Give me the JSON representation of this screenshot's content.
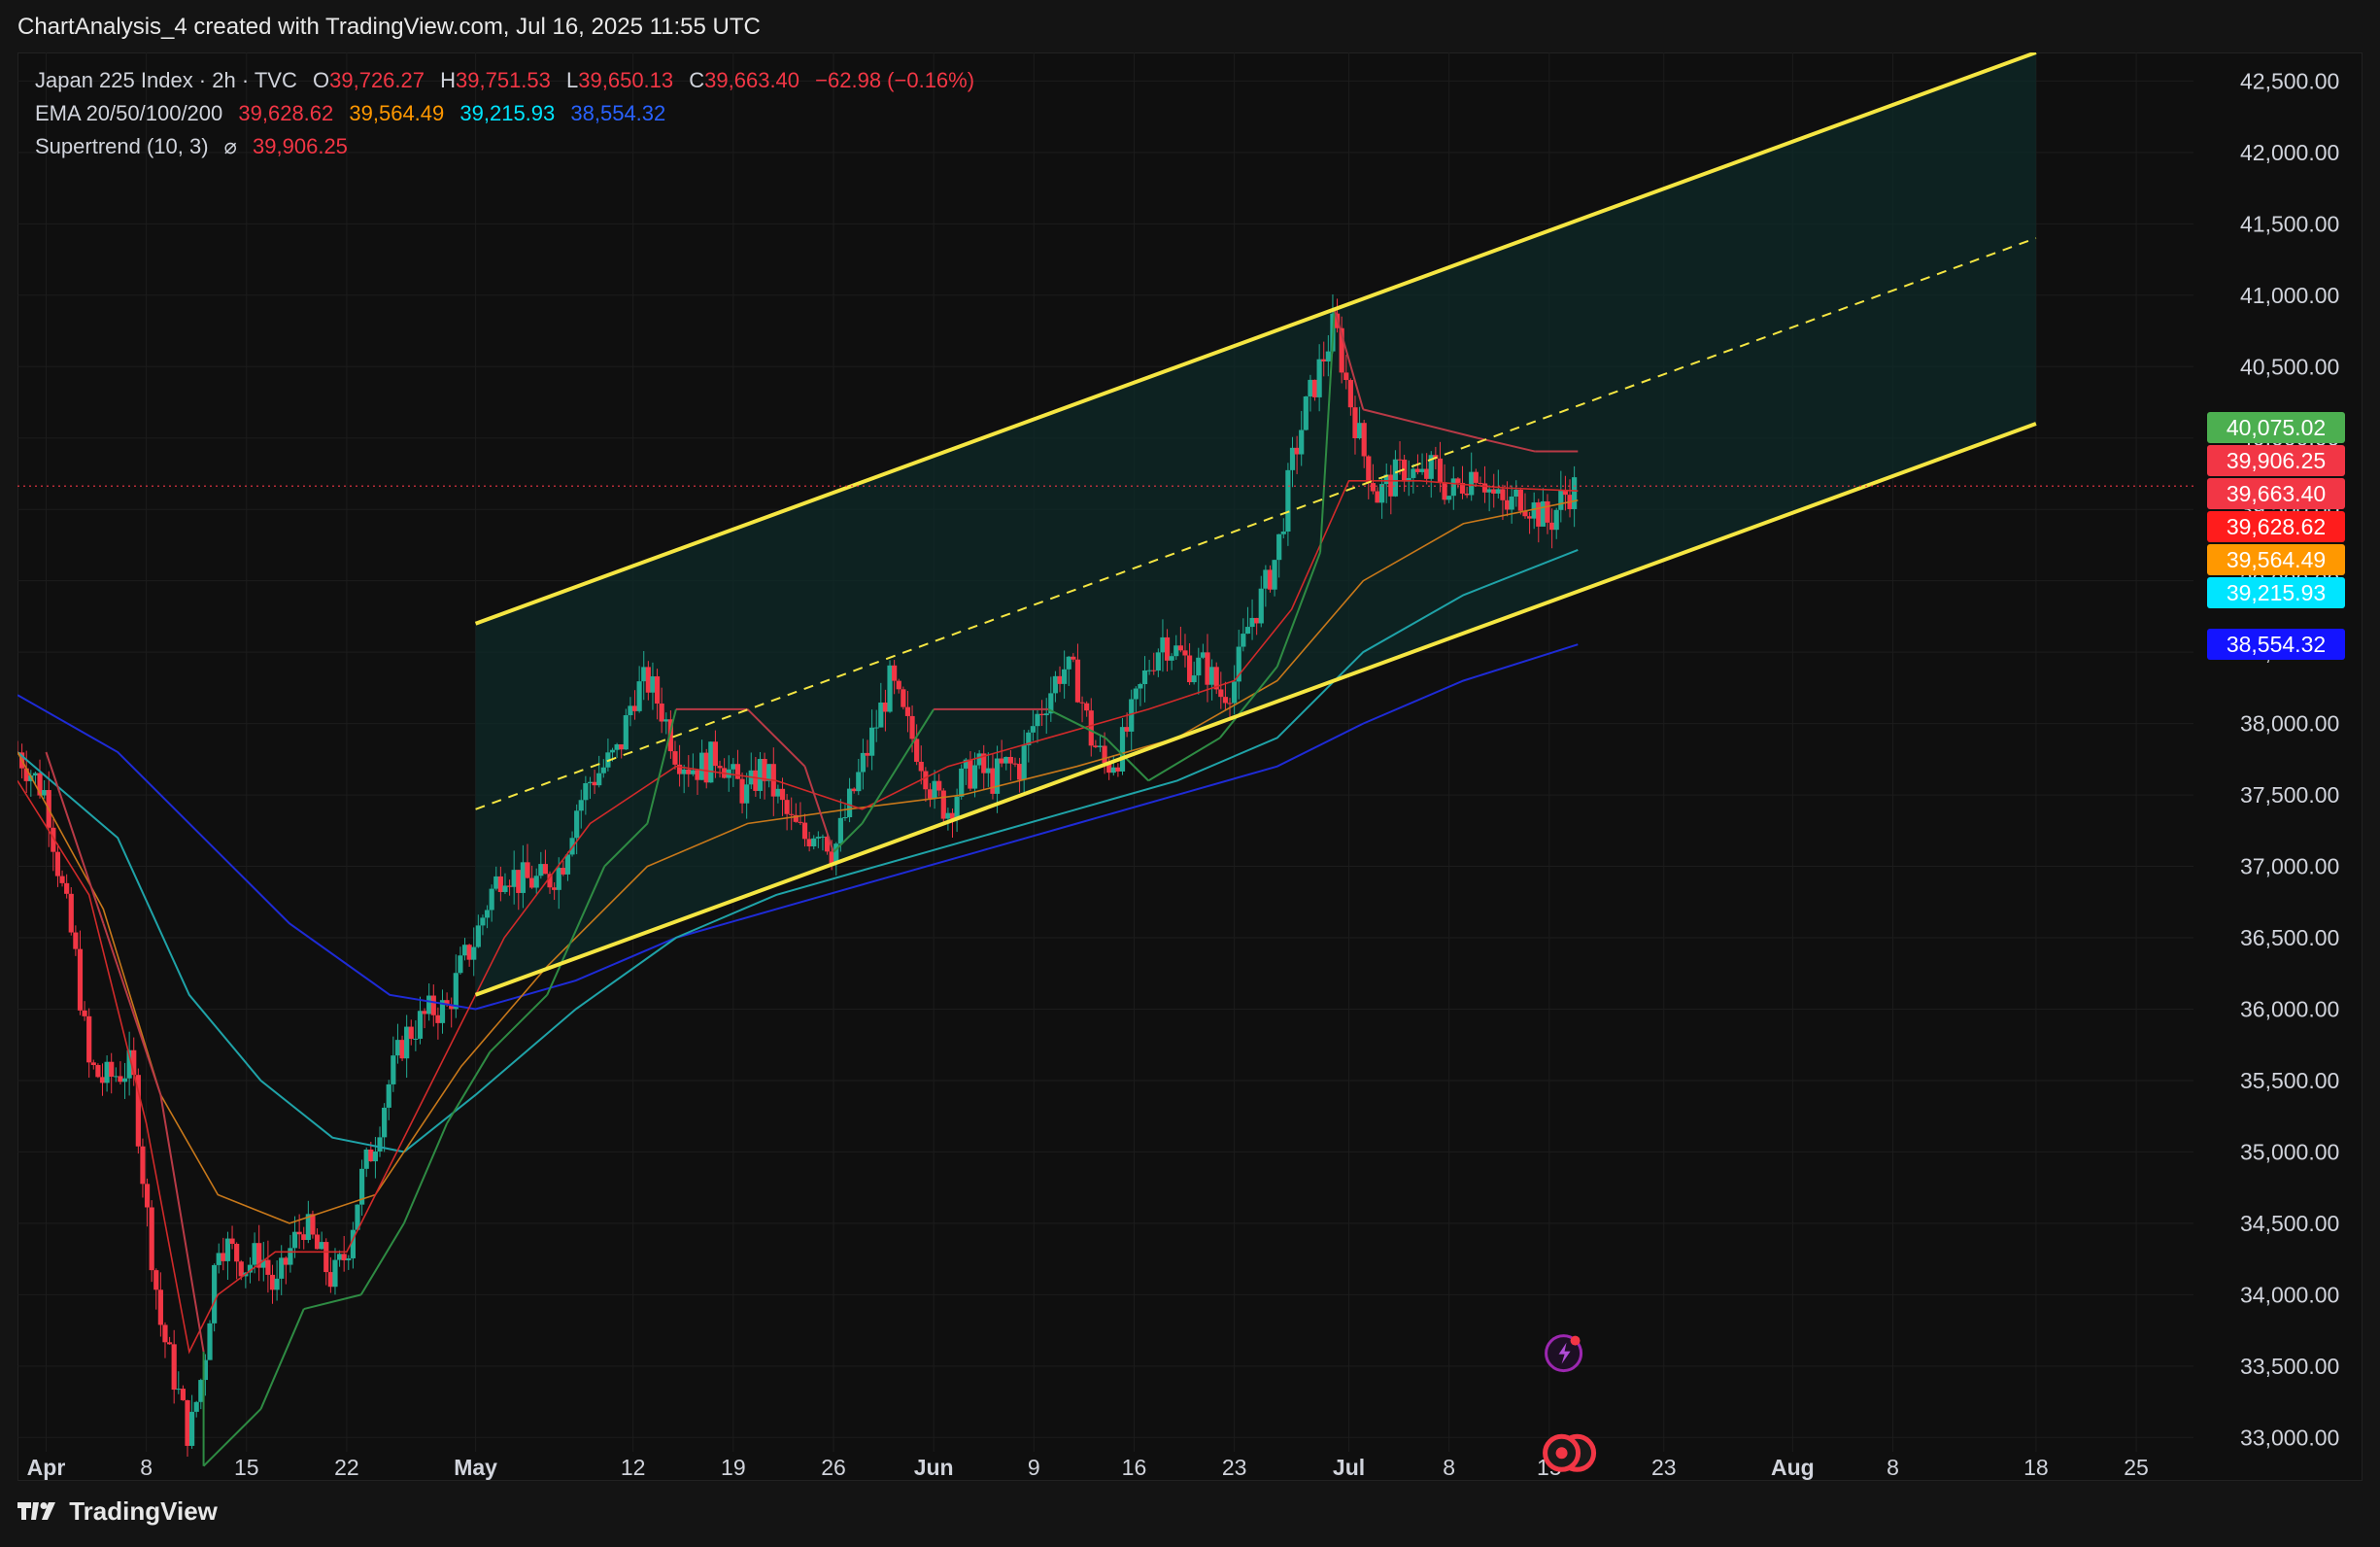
{
  "header": {
    "title": "ChartAnalysis_4 created with TradingView.com, Jul 16, 2025 11:55 UTC"
  },
  "legend": {
    "symbol": "Japan 225 Index · 2h · TVC",
    "o_label": "O",
    "o": "39,726.27",
    "h_label": "H",
    "h": "39,751.53",
    "l_label": "L",
    "l": "39,650.13",
    "c_label": "C",
    "c": "39,663.40",
    "change": "−62.98 (−0.16%)",
    "ema_label": "EMA 20/50/100/200",
    "ema20": "39,628.62",
    "ema50": "39,564.49",
    "ema100": "39,215.93",
    "ema200": "38,554.32",
    "st_label": "Supertrend (10, 3)",
    "st_symbol": "⌀",
    "st_value": "39,906.25"
  },
  "footer": {
    "brand": "TradingView"
  },
  "price_tags": [
    {
      "label": "40,075.02",
      "value": 40075.02,
      "color": "#4caf50"
    },
    {
      "label": "39,906.25",
      "value": 39906.25,
      "color": "#f23645"
    },
    {
      "label": "39,663.40",
      "value": 39663.4,
      "color": "#f23645"
    },
    {
      "label": "39,628.62",
      "value": 39628.62,
      "color": "#ff1c1c"
    },
    {
      "label": "39,564.49",
      "value": 39564.49,
      "color": "#ff9800"
    },
    {
      "label": "39,215.93",
      "value": 39215.93,
      "color": "#00e5ff"
    },
    {
      "label": "38,554.32",
      "value": 38554.32,
      "color": "#1414ff"
    }
  ],
  "chart_data": {
    "type": "candlestick",
    "symbol": "Japan 225 Index · 2h · TVC",
    "ylim": [
      32900,
      42700
    ],
    "y_ticks": [
      33000,
      33500,
      34000,
      34500,
      35000,
      35500,
      36000,
      36500,
      37000,
      37500,
      38000,
      38500,
      39000,
      39500,
      40000,
      40500,
      41000,
      41500,
      42000,
      42500
    ],
    "y_tick_labels": [
      "33,000.00",
      "33,500.00",
      "34,000.00",
      "34,500.00",
      "35,000.00",
      "35,500.00",
      "36,000.00",
      "36,500.00",
      "37,000.00",
      "37,500.00",
      "38,000.00",
      "38,500.00",
      "39,000.00",
      "39,500.00",
      "40,000.00",
      "40,500.00",
      "41,000.00",
      "41,500.00",
      "42,000.00",
      "42,500.00"
    ],
    "x_range": [
      "2025-03-30",
      "2025-08-29"
    ],
    "x_ticks": [
      {
        "date": "2025-04-01",
        "label": "Apr",
        "bold": true
      },
      {
        "date": "2025-04-08",
        "label": "8"
      },
      {
        "date": "2025-04-15",
        "label": "15"
      },
      {
        "date": "2025-04-22",
        "label": "22"
      },
      {
        "date": "2025-05-01",
        "label": "May",
        "bold": true
      },
      {
        "date": "2025-05-12",
        "label": "12"
      },
      {
        "date": "2025-05-19",
        "label": "19"
      },
      {
        "date": "2025-05-26",
        "label": "26"
      },
      {
        "date": "2025-06-02",
        "label": "Jun",
        "bold": true
      },
      {
        "date": "2025-06-09",
        "label": "9"
      },
      {
        "date": "2025-06-16",
        "label": "16"
      },
      {
        "date": "2025-06-23",
        "label": "23"
      },
      {
        "date": "2025-07-01",
        "label": "Jul",
        "bold": true
      },
      {
        "date": "2025-07-08",
        "label": "8"
      },
      {
        "date": "2025-07-15",
        "label": "15"
      },
      {
        "date": "2025-07-23",
        "label": "23"
      },
      {
        "date": "2025-08-01",
        "label": "Aug",
        "bold": true
      },
      {
        "date": "2025-08-08",
        "label": "8"
      },
      {
        "date": "2025-08-18",
        "label": "18"
      },
      {
        "date": "2025-08-25",
        "label": "25"
      }
    ],
    "price_path": [
      [
        "2025-03-30",
        37800
      ],
      [
        "2025-04-01",
        37500
      ],
      [
        "2025-04-02",
        36900
      ],
      [
        "2025-04-03",
        36400
      ],
      [
        "2025-04-04",
        35600
      ],
      [
        "2025-04-05",
        35500
      ],
      [
        "2025-04-07",
        35600
      ],
      [
        "2025-04-08",
        34600
      ],
      [
        "2025-04-09",
        33800
      ],
      [
        "2025-04-10",
        33400
      ],
      [
        "2025-04-11",
        33000
      ],
      [
        "2025-04-12",
        33500
      ],
      [
        "2025-04-13",
        34400
      ],
      [
        "2025-04-14",
        34300
      ],
      [
        "2025-04-15",
        34200
      ],
      [
        "2025-04-16",
        34300
      ],
      [
        "2025-04-17",
        34000
      ],
      [
        "2025-04-18",
        34300
      ],
      [
        "2025-04-19",
        34500
      ],
      [
        "2025-04-20",
        34300
      ],
      [
        "2025-04-21",
        34100
      ],
      [
        "2025-04-22",
        34300
      ],
      [
        "2025-04-23",
        34800
      ],
      [
        "2025-04-24",
        35100
      ],
      [
        "2025-04-25",
        35500
      ],
      [
        "2025-04-26",
        35800
      ],
      [
        "2025-04-27",
        35900
      ],
      [
        "2025-04-28",
        36000
      ],
      [
        "2025-04-29",
        36000
      ],
      [
        "2025-04-30",
        36300
      ],
      [
        "2025-05-01",
        36500
      ],
      [
        "2025-05-02",
        36800
      ],
      [
        "2025-05-03",
        37000
      ],
      [
        "2025-05-04",
        36900
      ],
      [
        "2025-05-06",
        36900
      ],
      [
        "2025-05-07",
        37000
      ],
      [
        "2025-05-08",
        37400
      ],
      [
        "2025-05-09",
        37600
      ],
      [
        "2025-05-10",
        37700
      ],
      [
        "2025-05-11",
        37800
      ],
      [
        "2025-05-12",
        38200
      ],
      [
        "2025-05-13",
        38300
      ],
      [
        "2025-05-14",
        38100
      ],
      [
        "2025-05-15",
        37800
      ],
      [
        "2025-05-16",
        37700
      ],
      [
        "2025-05-17",
        37700
      ],
      [
        "2025-05-18",
        37800
      ],
      [
        "2025-05-19",
        37600
      ],
      [
        "2025-05-20",
        37500
      ],
      [
        "2025-05-21",
        37700
      ],
      [
        "2025-05-22",
        37500
      ],
      [
        "2025-05-23",
        37300
      ],
      [
        "2025-05-24",
        37200
      ],
      [
        "2025-05-25",
        37300
      ],
      [
        "2025-05-26",
        37100
      ],
      [
        "2025-05-27",
        37400
      ],
      [
        "2025-05-28",
        37700
      ],
      [
        "2025-05-29",
        38000
      ],
      [
        "2025-05-30",
        38300
      ],
      [
        "2025-05-31",
        38000
      ],
      [
        "2025-06-01",
        37800
      ],
      [
        "2025-06-02",
        37500
      ],
      [
        "2025-06-03",
        37400
      ],
      [
        "2025-06-04",
        37600
      ],
      [
        "2025-06-05",
        37700
      ],
      [
        "2025-06-06",
        37600
      ],
      [
        "2025-06-07",
        37700
      ],
      [
        "2025-06-08",
        37700
      ],
      [
        "2025-06-09",
        38000
      ],
      [
        "2025-06-10",
        38200
      ],
      [
        "2025-06-11",
        38400
      ],
      [
        "2025-06-12",
        38300
      ],
      [
        "2025-06-13",
        37900
      ],
      [
        "2025-06-14",
        37700
      ],
      [
        "2025-06-15",
        37800
      ],
      [
        "2025-06-16",
        38100
      ],
      [
        "2025-06-17",
        38400
      ],
      [
        "2025-06-18",
        38600
      ],
      [
        "2025-06-19",
        38500
      ],
      [
        "2025-06-20",
        38400
      ],
      [
        "2025-06-21",
        38400
      ],
      [
        "2025-06-22",
        38200
      ],
      [
        "2025-06-23",
        38300
      ],
      [
        "2025-06-24",
        38700
      ],
      [
        "2025-06-25",
        38900
      ],
      [
        "2025-06-26",
        39200
      ],
      [
        "2025-06-27",
        39800
      ],
      [
        "2025-06-28",
        40200
      ],
      [
        "2025-06-29",
        40500
      ],
      [
        "2025-06-30",
        40800
      ],
      [
        "2025-07-01",
        40300
      ],
      [
        "2025-07-02",
        39900
      ],
      [
        "2025-07-03",
        39600
      ],
      [
        "2025-07-04",
        39700
      ],
      [
        "2025-07-05",
        39800
      ],
      [
        "2025-07-06",
        39700
      ],
      [
        "2025-07-07",
        39800
      ],
      [
        "2025-07-08",
        39600
      ],
      [
        "2025-07-09",
        39700
      ],
      [
        "2025-07-10",
        39800
      ],
      [
        "2025-07-11",
        39600
      ],
      [
        "2025-07-12",
        39500
      ],
      [
        "2025-07-13",
        39600
      ],
      [
        "2025-07-14",
        39500
      ],
      [
        "2025-07-15",
        39400
      ],
      [
        "2025-07-16",
        39600
      ],
      [
        "2025-07-17",
        39663
      ]
    ],
    "ema20_path": [
      [
        "2025-03-30",
        37600
      ],
      [
        "2025-04-04",
        36800
      ],
      [
        "2025-04-08",
        35200
      ],
      [
        "2025-04-11",
        33600
      ],
      [
        "2025-04-13",
        34000
      ],
      [
        "2025-04-17",
        34300
      ],
      [
        "2025-04-22",
        34300
      ],
      [
        "2025-04-28",
        35500
      ],
      [
        "2025-05-03",
        36500
      ],
      [
        "2025-05-09",
        37300
      ],
      [
        "2025-05-15",
        37700
      ],
      [
        "2025-05-22",
        37600
      ],
      [
        "2025-05-28",
        37400
      ],
      [
        "2025-06-03",
        37700
      ],
      [
        "2025-06-10",
        37900
      ],
      [
        "2025-06-17",
        38100
      ],
      [
        "2025-06-23",
        38300
      ],
      [
        "2025-06-27",
        38800
      ],
      [
        "2025-07-01",
        39700
      ],
      [
        "2025-07-06",
        39700
      ],
      [
        "2025-07-12",
        39650
      ],
      [
        "2025-07-17",
        39629
      ]
    ],
    "ema50_path": [
      [
        "2025-03-30",
        37800
      ],
      [
        "2025-04-05",
        36700
      ],
      [
        "2025-04-09",
        35400
      ],
      [
        "2025-04-13",
        34700
      ],
      [
        "2025-04-18",
        34500
      ],
      [
        "2025-04-24",
        34700
      ],
      [
        "2025-04-30",
        35600
      ],
      [
        "2025-05-06",
        36300
      ],
      [
        "2025-05-13",
        37000
      ],
      [
        "2025-05-20",
        37300
      ],
      [
        "2025-05-27",
        37400
      ],
      [
        "2025-06-04",
        37500
      ],
      [
        "2025-06-12",
        37700
      ],
      [
        "2025-06-19",
        37900
      ],
      [
        "2025-06-26",
        38300
      ],
      [
        "2025-07-02",
        39000
      ],
      [
        "2025-07-09",
        39400
      ],
      [
        "2025-07-17",
        39564
      ]
    ],
    "ema100_path": [
      [
        "2025-03-30",
        37800
      ],
      [
        "2025-04-06",
        37200
      ],
      [
        "2025-04-11",
        36100
      ],
      [
        "2025-04-16",
        35500
      ],
      [
        "2025-04-21",
        35100
      ],
      [
        "2025-04-26",
        35000
      ],
      [
        "2025-05-01",
        35400
      ],
      [
        "2025-05-08",
        36000
      ],
      [
        "2025-05-15",
        36500
      ],
      [
        "2025-05-22",
        36800
      ],
      [
        "2025-05-29",
        37000
      ],
      [
        "2025-06-05",
        37200
      ],
      [
        "2025-06-12",
        37400
      ],
      [
        "2025-06-19",
        37600
      ],
      [
        "2025-06-26",
        37900
      ],
      [
        "2025-07-02",
        38500
      ],
      [
        "2025-07-09",
        38900
      ],
      [
        "2025-07-17",
        39216
      ]
    ],
    "ema200_path": [
      [
        "2025-03-30",
        38200
      ],
      [
        "2025-04-06",
        37800
      ],
      [
        "2025-04-12",
        37200
      ],
      [
        "2025-04-18",
        36600
      ],
      [
        "2025-04-25",
        36100
      ],
      [
        "2025-05-01",
        36000
      ],
      [
        "2025-05-08",
        36200
      ],
      [
        "2025-05-15",
        36500
      ],
      [
        "2025-05-22",
        36700
      ],
      [
        "2025-05-29",
        36900
      ],
      [
        "2025-06-05",
        37100
      ],
      [
        "2025-06-12",
        37300
      ],
      [
        "2025-06-19",
        37500
      ],
      [
        "2025-06-26",
        37700
      ],
      [
        "2025-07-02",
        38000
      ],
      [
        "2025-07-09",
        38300
      ],
      [
        "2025-07-17",
        38554
      ]
    ],
    "supertrend_path": [
      [
        "2025-04-01",
        37800
      ],
      [
        "2025-04-05",
        36600
      ],
      [
        "2025-04-09",
        35400
      ],
      [
        "2025-04-12",
        33600
      ],
      [
        "2025-04-12",
        32800
      ],
      [
        "2025-04-16",
        33200
      ],
      [
        "2025-04-19",
        33900
      ],
      [
        "2025-04-23",
        34000
      ],
      [
        "2025-04-26",
        34500
      ],
      [
        "2025-04-29",
        35200
      ],
      [
        "2025-05-02",
        35700
      ],
      [
        "2025-05-06",
        36100
      ],
      [
        "2025-05-10",
        37000
      ],
      [
        "2025-05-13",
        37300
      ],
      [
        "2025-05-15",
        38100
      ],
      [
        "2025-05-20",
        38100
      ],
      [
        "2025-05-24",
        37700
      ],
      [
        "2025-05-26",
        37100
      ],
      [
        "2025-05-28",
        37300
      ],
      [
        "2025-06-02",
        38100
      ],
      [
        "2025-06-10",
        38100
      ],
      [
        "2025-06-14",
        37900
      ],
      [
        "2025-06-17",
        37600
      ],
      [
        "2025-06-22",
        37900
      ],
      [
        "2025-06-26",
        38400
      ],
      [
        "2025-06-29",
        39200
      ],
      [
        "2025-06-30",
        40900
      ],
      [
        "2025-07-02",
        40200
      ],
      [
        "2025-07-06",
        40100
      ],
      [
        "2025-07-10",
        40000
      ],
      [
        "2025-07-14",
        39906
      ],
      [
        "2025-07-17",
        39906
      ]
    ],
    "channel": {
      "start": "2025-05-01",
      "end": "2025-08-18",
      "upper": [
        38700,
        42700
      ],
      "mid": [
        37400,
        41400
      ],
      "lower": [
        36100,
        40100
      ]
    },
    "last_price": 39663.4
  }
}
